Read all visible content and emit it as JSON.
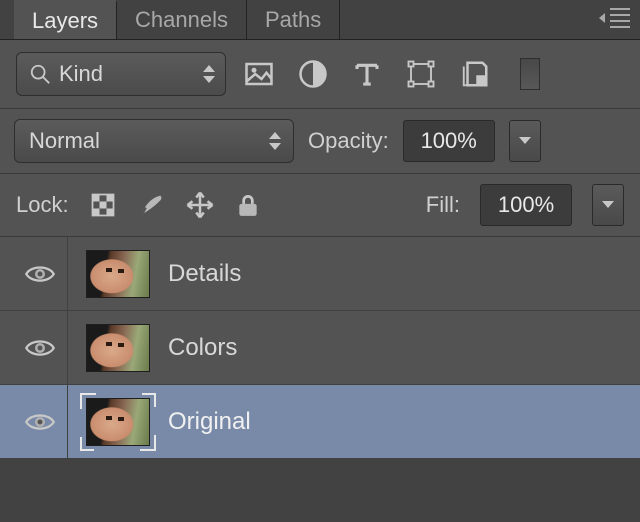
{
  "tabs": [
    "Layers",
    "Channels",
    "Paths"
  ],
  "active_tab": 0,
  "filter": {
    "kind_label": "Kind"
  },
  "blend": {
    "mode": "Normal",
    "opacity_label": "Opacity:",
    "opacity_value": "100%",
    "fill_label": "Fill:",
    "fill_value": "100%"
  },
  "lock": {
    "label": "Lock:"
  },
  "layers": [
    {
      "name": "Details",
      "visible": true,
      "selected": false
    },
    {
      "name": "Colors",
      "visible": true,
      "selected": false
    },
    {
      "name": "Original",
      "visible": true,
      "selected": true
    }
  ]
}
